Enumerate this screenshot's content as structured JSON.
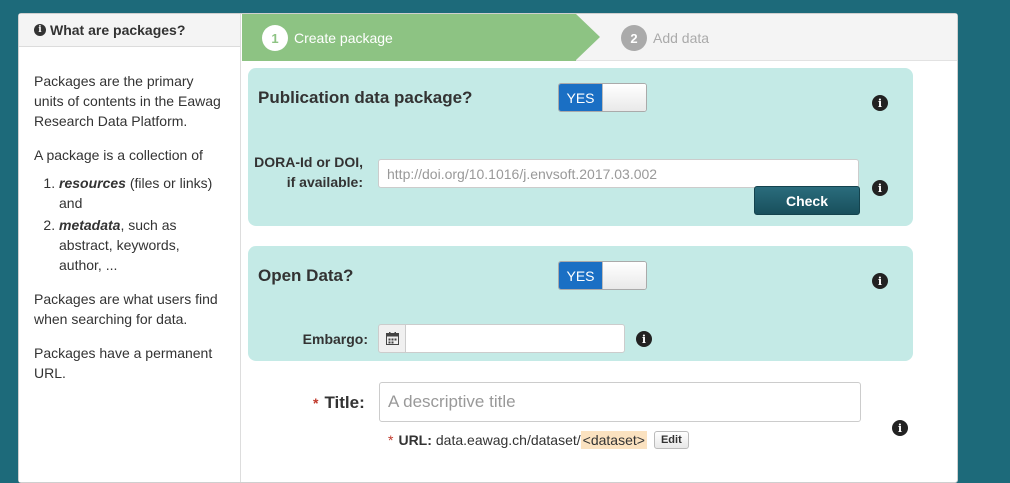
{
  "sidebar": {
    "heading": "What are packages?",
    "para1": "Packages are the primary units of contents in the Eawag Research Data Platform.",
    "para2": "A package is a collection of",
    "list": [
      {
        "term": "resources",
        "rest": " (files or links) and"
      },
      {
        "term": "metadata",
        "rest": ", such as abstract, keywords, author, ..."
      }
    ],
    "para3": "Packages are what users find when searching for data.",
    "para4": "Packages have a permanent URL."
  },
  "steps": [
    {
      "number": "1",
      "label": "Create package",
      "active": true
    },
    {
      "number": "2",
      "label": "Add data",
      "active": false
    }
  ],
  "publication": {
    "question": "Publication data package?",
    "toggle_label": "YES",
    "doi_label_line1": "DORA-Id or DOI,",
    "doi_label_line2": "if available:",
    "doi_placeholder": "http://doi.org/10.1016/j.envsoft.2017.03.002",
    "check_label": "Check"
  },
  "open_data": {
    "question": "Open Data?",
    "toggle_label": "YES",
    "embargo_label": "Embargo:",
    "embargo_value": ""
  },
  "title_field": {
    "required_mark": "*",
    "label": "Title:",
    "placeholder": "A descriptive title",
    "url_label": "URL:",
    "url_prefix": "data.eawag.ch/dataset/",
    "url_slug": "<dataset>",
    "edit_label": "Edit"
  },
  "icons": {
    "info": "info-circle-icon",
    "calendar": "calendar-icon"
  },
  "colors": {
    "background": "#1d6a7a",
    "panel": "#c4eae6",
    "active_step": "#8dc383",
    "toggle_on": "#1a6fc4",
    "check_button": "#1f5d6b"
  }
}
